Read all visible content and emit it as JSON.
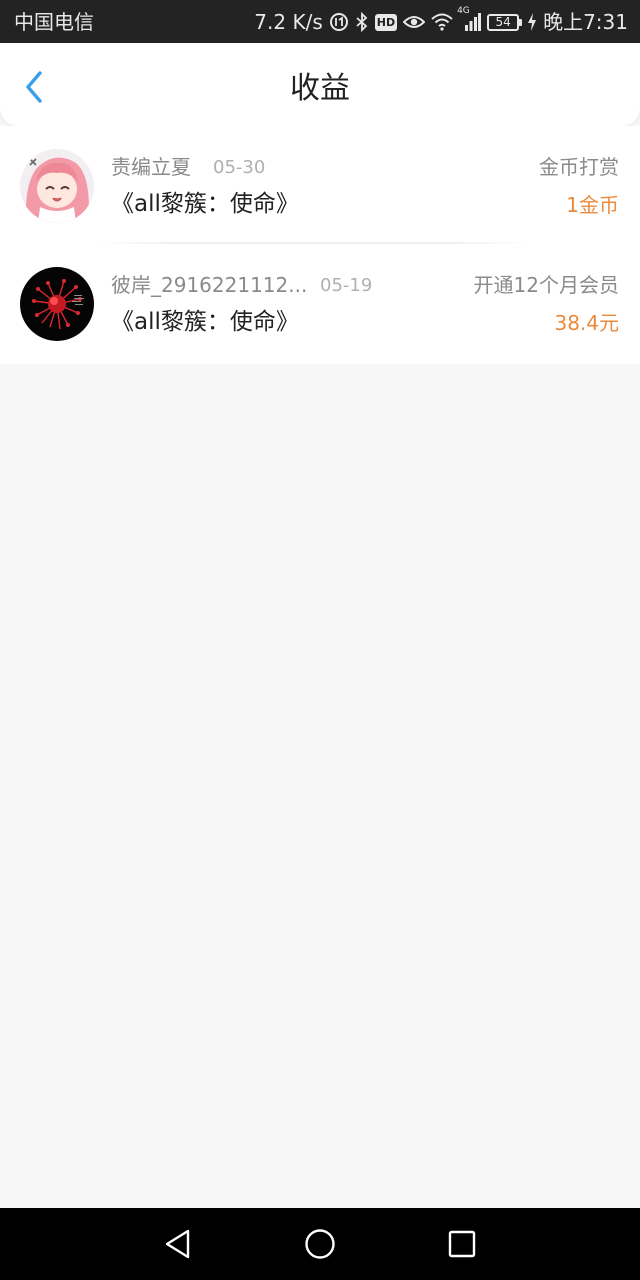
{
  "status_bar": {
    "carrier": "中国电信",
    "speed": "7.2 K/s",
    "hd_badge": "HD",
    "network": "4G",
    "battery": "54",
    "time": "晚上7:31"
  },
  "header": {
    "title": "收益",
    "back_icon": "chevron-left-icon"
  },
  "income_list": [
    {
      "user": "责编立夏",
      "date": "05-30",
      "book": "《all黎簇：使命》",
      "type": "金币打赏",
      "amount": "1金币",
      "avatar": "anime-avatar"
    },
    {
      "user": "彼岸_2916221112...",
      "date": "05-19",
      "book": "《all黎簇：使命》",
      "type": "开通12个月会员",
      "amount": "38.4元",
      "avatar": "red-flower-avatar"
    }
  ],
  "colors": {
    "accent_blue": "#3a9ee8",
    "amount_orange": "#ec8a3c",
    "status_bar_bg": "#232323",
    "page_bg": "#f8f7f8"
  },
  "nav_icons": [
    "back-triangle-icon",
    "home-circle-icon",
    "recents-square-icon"
  ]
}
